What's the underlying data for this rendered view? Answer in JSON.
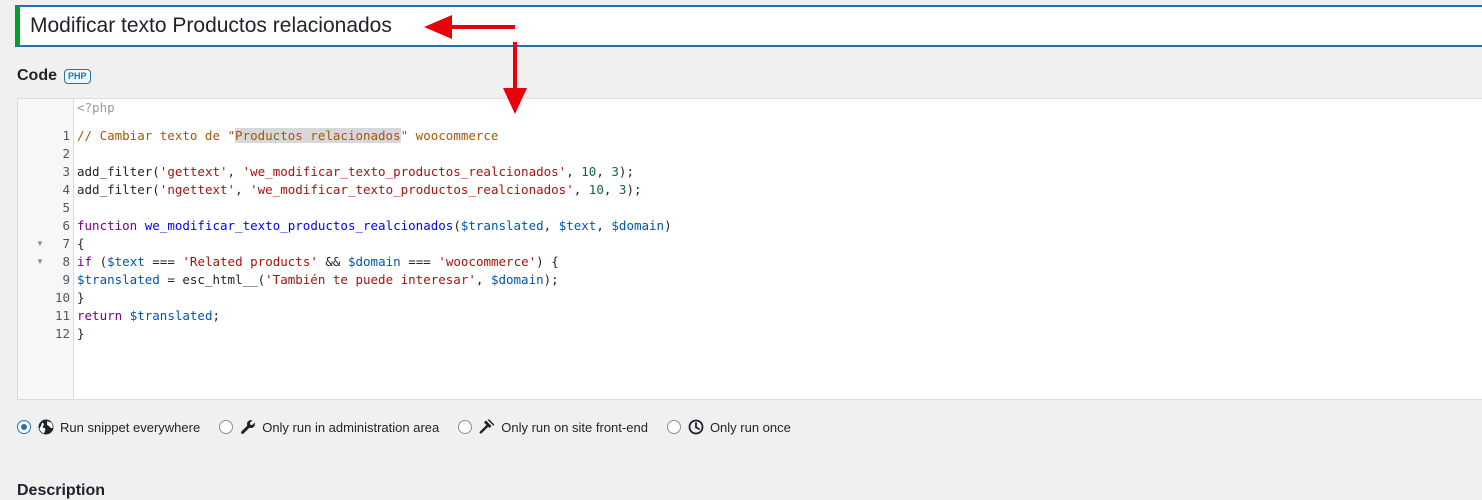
{
  "title_input": {
    "value": "Modificar texto Productos relacionados"
  },
  "code_section": {
    "label": "Code",
    "badge": "PHP"
  },
  "editor": {
    "php_open_tag": "<?php",
    "line_numbers": [
      "1",
      "2",
      "3",
      "4",
      "5",
      "6",
      "7",
      "8",
      "9",
      "10",
      "11",
      "12"
    ],
    "lines": {
      "l1": {
        "pre": "// Cambiar texto de \"",
        "highlight": "Productos relacionados",
        "post": "\" woocommerce"
      },
      "l3": {
        "fn": "add_filter(",
        "s1": "'gettext'",
        "c1": ", ",
        "s2": "'we_modificar_texto_productos_realcionados'",
        "c2": ", ",
        "n1": "10",
        "c3": ", ",
        "n2": "3",
        "end": ");"
      },
      "l4": {
        "fn": "add_filter(",
        "s1": "'ngettext'",
        "c1": ", ",
        "s2": "'we_modificar_texto_productos_realcionados'",
        "c2": ", ",
        "n1": "10",
        "c3": ", ",
        "n2": "3",
        "end": ");"
      },
      "l6": {
        "kw": "function",
        "sp": " ",
        "def": "we_modificar_texto_productos_realcionados",
        "p1": "(",
        "v1": "$translated",
        "c1": ", ",
        "v2": "$text",
        "c2": ", ",
        "v3": "$domain",
        "p2": ")"
      },
      "l7": {
        "text": "{"
      },
      "l8": {
        "kw": "if",
        "p1": " (",
        "v1": "$text",
        "op1": " === ",
        "s1": "'Related products'",
        "op2": " && ",
        "v2": "$domain",
        "op3": " === ",
        "s2": "'woocommerce'",
        "p2": ") {"
      },
      "l9": {
        "v1": "$translated",
        "op1": " = esc_html__(",
        "s1": "'También te puede interesar'",
        "c1": ", ",
        "v2": "$domain",
        "end": ");"
      },
      "l10": {
        "text": "}"
      },
      "l11": {
        "kw": "return",
        "sp": " ",
        "v1": "$translated",
        "end": ";"
      },
      "l12": {
        "text": "}"
      }
    }
  },
  "run_options": [
    {
      "label": "Run snippet everywhere",
      "icon": "globe-icon",
      "checked": true
    },
    {
      "label": "Only run in administration area",
      "icon": "wrench-icon",
      "checked": false
    },
    {
      "label": "Only run on site front-end",
      "icon": "hammer-icon",
      "checked": false
    },
    {
      "label": "Only run once",
      "icon": "clock-icon",
      "checked": false
    }
  ],
  "description_section": {
    "label": "Description"
  },
  "annotation_color": "#e8000b"
}
